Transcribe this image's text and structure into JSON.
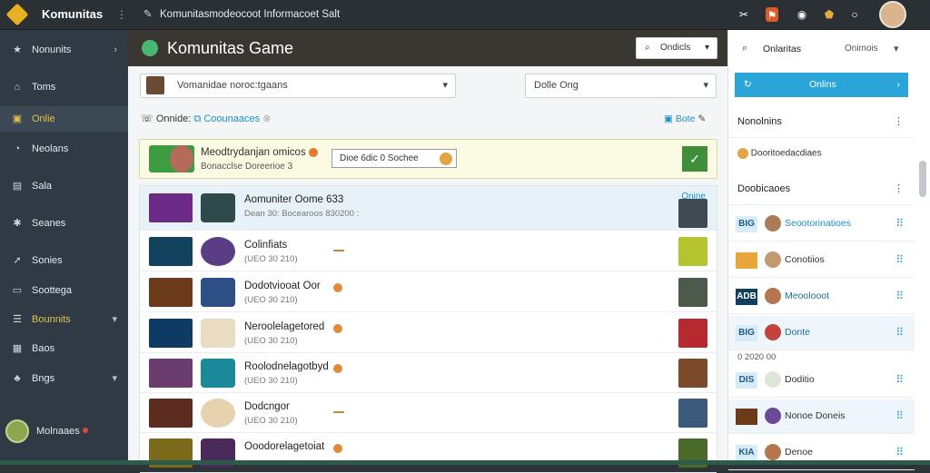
{
  "topbar": {
    "brand": "Komunitas",
    "address": "Komunitasmodeocoot Informacoet Salt",
    "icons": [
      "pin-icon",
      "tools-icon",
      "flag-icon",
      "camera-icon",
      "shield-icon",
      "circle-icon"
    ]
  },
  "sidebar": {
    "items": [
      {
        "label": "Nonunits",
        "icon": "star-icon",
        "chevron": "›"
      },
      {
        "label": "Toms",
        "icon": "home-icon",
        "chevron": ""
      },
      {
        "label": "Onlie",
        "icon": "briefcase-icon",
        "chevron": ""
      },
      {
        "label": "Neolans",
        "icon": "bell-icon",
        "chevron": ""
      },
      {
        "label": "Sala",
        "icon": "chart-icon",
        "chevron": ""
      },
      {
        "label": "Seanes",
        "icon": "gear-icon",
        "chevron": ""
      },
      {
        "label": "Sonies",
        "icon": "pin-icon",
        "chevron": ""
      },
      {
        "label": "Soottega",
        "icon": "box-icon",
        "chevron": ""
      },
      {
        "label": "Bounnits",
        "icon": "layers-icon",
        "chevron": "▾"
      },
      {
        "label": "Baos",
        "icon": "image-icon",
        "chevron": ""
      },
      {
        "label": "Bngs",
        "icon": "tree-icon",
        "chevron": "▾"
      }
    ],
    "user_label": "Molnaaes"
  },
  "main": {
    "title": "Komunitas Game",
    "search_btn": "Ondicls",
    "select1": "Vomanidae noroc:tgaans",
    "select2": "Dolle Ong",
    "filter_label": "Onnide:",
    "filter_chip": "Coounaaces",
    "filter_right": "Bote",
    "promo": {
      "title": "Meodtrydanjan omicos",
      "subtitle": "Bonacclse Doreerioe 3",
      "box": "Dioe 6dic 0 Sochee"
    },
    "rows": [
      {
        "name": "Aomuniter Oome 633",
        "sub": "Dean 30: Bocearoos 830200 :",
        "status": "Onine",
        "highlight": true
      },
      {
        "name": "Colinfiats",
        "sub": "(UEO 30 210)",
        "status": "",
        "highlight": false
      },
      {
        "name": "Dodotviooat Oor",
        "sub": "(UEO 30 210)",
        "status": "",
        "highlight": false
      },
      {
        "name": "Neroolelagetored",
        "sub": "(UEO 30 210)",
        "status": "",
        "highlight": false
      },
      {
        "name": "Roolodnelagotbyd",
        "sub": "(UEO 30 210)",
        "status": "",
        "highlight": false
      },
      {
        "name": "Dodcngor",
        "sub": "(UEO 30 210)",
        "status": "",
        "highlight": false
      },
      {
        "name": "Ooodorelagetoiat",
        "sub": "",
        "status": "",
        "highlight": false
      }
    ]
  },
  "right": {
    "header": "Onlaritas",
    "header_right": "Onimois",
    "button": "Onlins",
    "sections": [
      {
        "label": "Nonolnins"
      },
      {
        "label": "Doobicaoes"
      }
    ],
    "sub_item": "Dooritoedacdiaes",
    "mid_label": "0 2020 00",
    "rows": [
      {
        "tag": "BIG",
        "name": "Seootorinatioes",
        "blue": true
      },
      {
        "tag": "",
        "name": "Conotiios",
        "blue": false
      },
      {
        "tag": "ADB",
        "name": "Meoolooot",
        "blue": false
      },
      {
        "tag": "BIG",
        "name": "Donte",
        "blue": true
      },
      {
        "tag": "DIS",
        "name": "Doditio",
        "blue": false
      },
      {
        "tag": "",
        "name": "Nonoe Doneis",
        "blue": false
      },
      {
        "tag": "KIA",
        "name": "Denoe",
        "blue": false
      }
    ]
  },
  "colors": {
    "accent": "#2aa4d9",
    "brand_gold": "#e0c24a",
    "promo_green": "#3f8f3a",
    "topbar": "#2b3035",
    "sidebar": "#2f3a45"
  }
}
